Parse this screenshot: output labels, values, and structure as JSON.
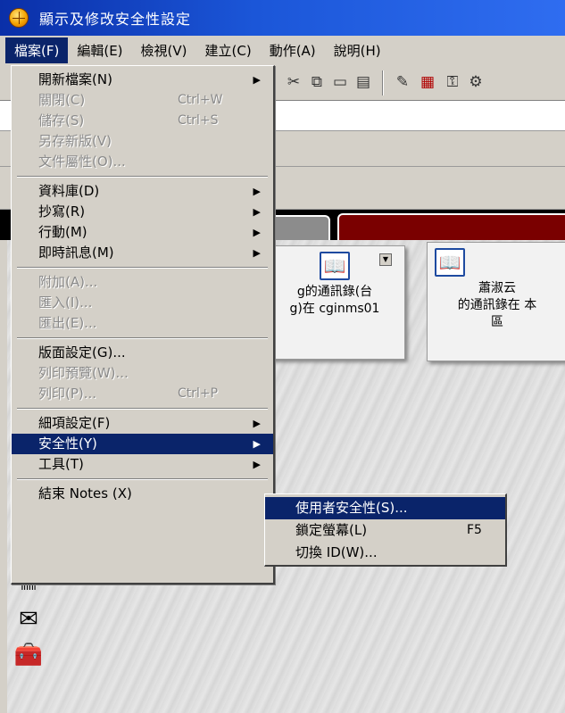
{
  "window": {
    "title": "顯示及修改安全性設定"
  },
  "menubar": {
    "items": [
      "檔案(F)",
      "編輯(E)",
      "檢視(V)",
      "建立(C)",
      "動作(A)",
      "說明(H)"
    ]
  },
  "file_menu": {
    "items": [
      {
        "label": "開新檔案(N)",
        "shortcut": "",
        "submenu": true,
        "disabled": false
      },
      {
        "label": "關閉(C)",
        "shortcut": "Ctrl+W",
        "submenu": false,
        "disabled": true
      },
      {
        "label": "儲存(S)",
        "shortcut": "Ctrl+S",
        "submenu": false,
        "disabled": true
      },
      {
        "label": "另存新版(V)",
        "shortcut": "",
        "submenu": false,
        "disabled": true
      },
      {
        "label": "文件屬性(O)...",
        "shortcut": "",
        "submenu": false,
        "disabled": true
      },
      {
        "label": "資料庫(D)",
        "shortcut": "",
        "submenu": true,
        "disabled": false
      },
      {
        "label": "抄寫(R)",
        "shortcut": "",
        "submenu": true,
        "disabled": false
      },
      {
        "label": "行動(M)",
        "shortcut": "",
        "submenu": true,
        "disabled": false
      },
      {
        "label": "即時訊息(M)",
        "shortcut": "",
        "submenu": true,
        "disabled": false
      },
      {
        "label": "附加(A)...",
        "shortcut": "",
        "submenu": false,
        "disabled": true
      },
      {
        "label": "匯入(I)...",
        "shortcut": "",
        "submenu": false,
        "disabled": true
      },
      {
        "label": "匯出(E)...",
        "shortcut": "",
        "submenu": false,
        "disabled": true
      },
      {
        "label": "版面設定(G)...",
        "shortcut": "",
        "submenu": false,
        "disabled": false
      },
      {
        "label": "列印預覽(W)...",
        "shortcut": "",
        "submenu": false,
        "disabled": true
      },
      {
        "label": "列印(P)...",
        "shortcut": "Ctrl+P",
        "submenu": false,
        "disabled": true
      },
      {
        "label": "細項設定(F)",
        "shortcut": "",
        "submenu": true,
        "disabled": false
      },
      {
        "label": "安全性(Y)",
        "shortcut": "",
        "submenu": true,
        "disabled": false,
        "highlighted": true
      },
      {
        "label": "工具(T)",
        "shortcut": "",
        "submenu": true,
        "disabled": false
      },
      {
        "label": "結束 Notes (X)",
        "shortcut": "",
        "submenu": false,
        "disabled": false
      }
    ]
  },
  "security_submenu": {
    "items": [
      {
        "label": "使用者安全性(S)...",
        "shortcut": "",
        "highlighted": true
      },
      {
        "label": "鎖定螢幕(L)",
        "shortcut": "F5"
      },
      {
        "label": "切換 ID(W)...",
        "shortcut": ""
      }
    ]
  },
  "cards": [
    {
      "line1": "g的通訊錄(台",
      "line2": "g)在 cginms01",
      "line3": ""
    },
    {
      "line1": "蕭淑云",
      "line2": "的通訊錄在 本",
      "line3": "區"
    }
  ],
  "icons": {
    "app": "lotus-notes-icon",
    "toolbar": [
      "cut-icon",
      "copy-icon",
      "paste-icon",
      "paste-special-icon",
      "new-memo-icon",
      "calendar-icon",
      "key-icon",
      "tools-icon"
    ],
    "sidebar": [
      "database-icon",
      "mail-icon",
      "toolbox-icon"
    ]
  },
  "colors": {
    "titlebar": "#0a2fa8",
    "highlight": "#0a246a",
    "menu_bg": "#d4d0c8",
    "tab_red": "#7a0000",
    "tab_grey": "#8c8c8c"
  }
}
